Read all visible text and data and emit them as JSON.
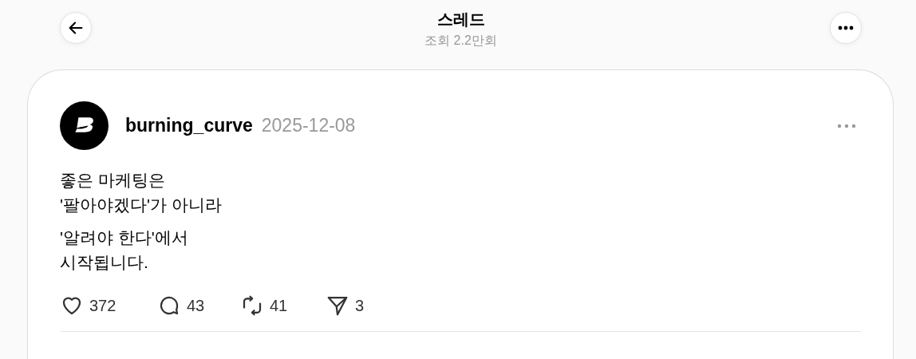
{
  "header": {
    "title": "스레드",
    "views": "조회 2.2만회"
  },
  "post": {
    "author": "burning_curve",
    "date": "2025-12-08",
    "paragraphs": [
      [
        "좋은 마케팅은",
        "'팔아야겠다'가 아니라"
      ],
      [
        "'알려야 한다'에서",
        "시작됩니다."
      ]
    ],
    "actions": [
      {
        "kind": "like",
        "count": "372"
      },
      {
        "kind": "reply",
        "count": "43"
      },
      {
        "kind": "repost",
        "count": "41"
      },
      {
        "kind": "share",
        "count": "3"
      }
    ]
  }
}
